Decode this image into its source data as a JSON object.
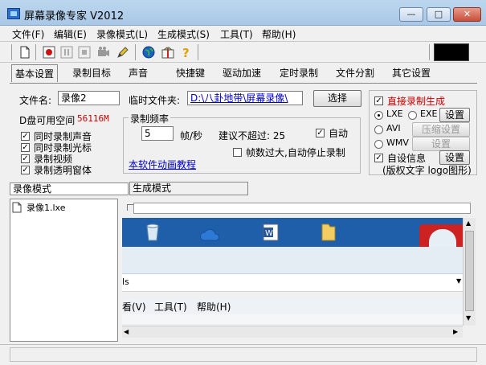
{
  "window": {
    "title": "屏幕录像专家 V2012"
  },
  "menu": [
    "文件(F)",
    "编辑(E)",
    "录像模式(L)",
    "生成模式(S)",
    "工具(T)",
    "帮助(H)"
  ],
  "tabs": [
    "基本设置",
    "录制目标",
    "声音",
    "快捷键",
    "驱动加速",
    "定时录制",
    "文件分割",
    "其它设置"
  ],
  "basic": {
    "filename_label": "文件名:",
    "filename_value": "录像2",
    "tempdir_label": "临时文件夹:",
    "tempdir_value": "D:\\八卦地带\\屏幕录像\\",
    "select_button": "选择",
    "disk_label": "D盘可用空间",
    "disk_value": "56116M",
    "options": [
      "同时录制声音",
      "同时录制光标",
      "录制视频",
      "录制透明窗体"
    ],
    "freq_group": "录制频率",
    "freq_value": "5",
    "freq_unit": "帧/秒",
    "suggest_text": "建议不超过: 25",
    "auto_label": "自动",
    "stop_label": "帧数过大,自动停止录制",
    "tutorial_link": "本软件动画教程"
  },
  "output": {
    "direct_label": "直接录制生成",
    "formats": [
      "LXE",
      "EXE",
      "AVI",
      "WMV"
    ],
    "set_button": "设置",
    "compress_button": "压缩设置",
    "set_button_disabled": "设置",
    "custom_label": "自设信息",
    "custom_set_button": "设置",
    "custom_note": "(版权文字 logo图形)"
  },
  "mode_tabs": [
    "录像模式",
    "生成模式"
  ],
  "file_list": [
    "录像1.lxe"
  ],
  "preview": {
    "address_text": "ls",
    "menu_items": [
      "看(V)",
      "工具(T)",
      "帮助(H)"
    ]
  },
  "colors": {
    "titlebar": "#bcd6ee",
    "accent": "#cc0000",
    "link": "#0000cc",
    "taskbar": "#1f5ea8"
  }
}
